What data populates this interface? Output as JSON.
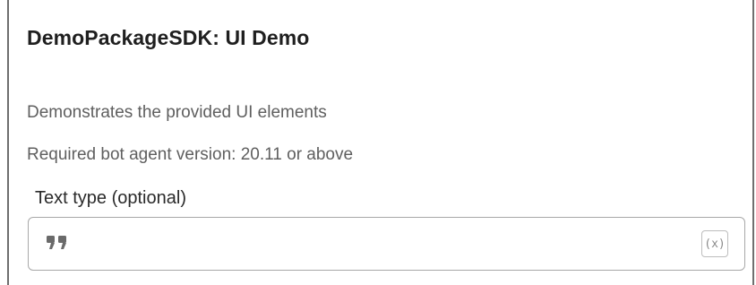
{
  "panel": {
    "title": "DemoPackageSDK: UI Demo",
    "description": "Demonstrates the provided UI elements",
    "requirement": "Required bot agent version: 20.11 or above"
  },
  "text_field": {
    "label": "Text type (optional)",
    "value": "",
    "placeholder": "",
    "left_icon": "quote-icon",
    "right_icon": "variable-insert-icon",
    "right_icon_glyph": "(x)"
  },
  "colors": {
    "title_text": "#1f1f1f",
    "secondary_text": "#5f5f5f",
    "border": "#a8a8a8",
    "icon": "#6a6a6a"
  }
}
